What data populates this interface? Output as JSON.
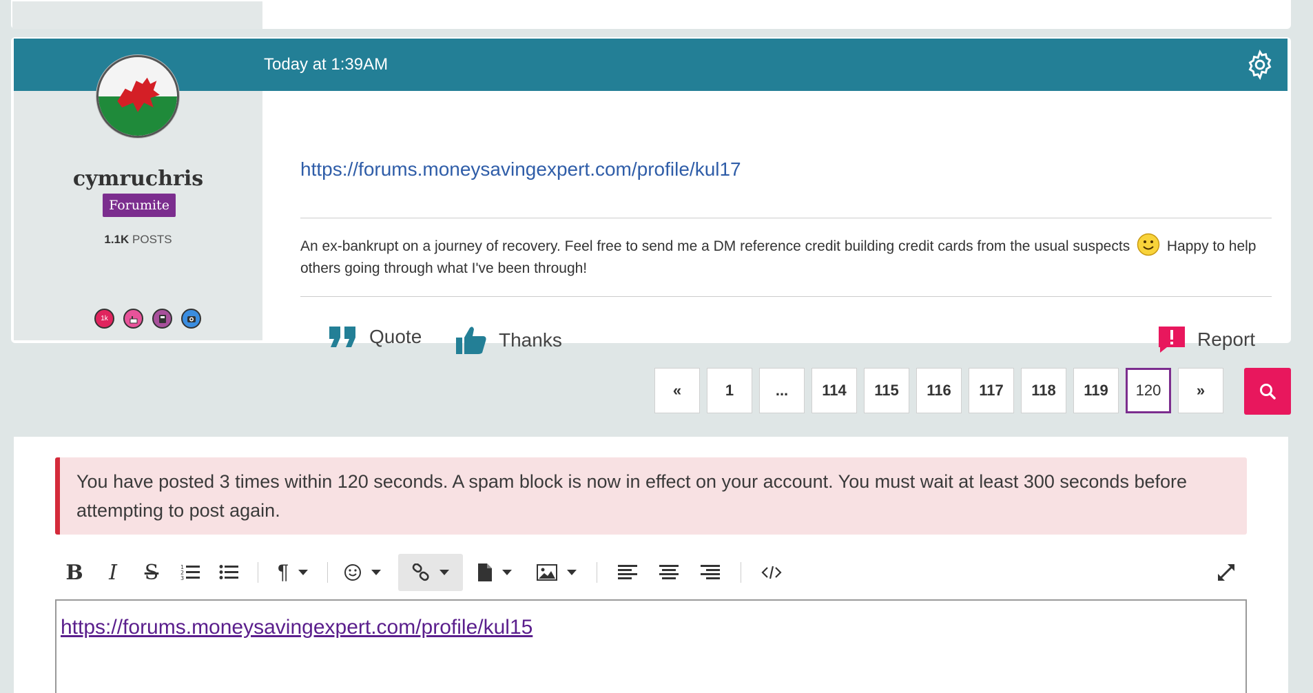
{
  "post": {
    "timestamp": "Today at 1:39AM",
    "author": {
      "username": "cymruchris",
      "rank": "Forumite",
      "post_count": "1.1K",
      "post_label": "POSTS",
      "badges": [
        {
          "icon": "1k-posts-badge",
          "label": "1k",
          "color": "#e0245e"
        },
        {
          "icon": "cake-badge",
          "label": "",
          "color": "#e8539a"
        },
        {
          "icon": "book-badge",
          "label": "",
          "color": "#a8509c"
        },
        {
          "icon": "camera-badge",
          "label": "",
          "color": "#3a8de0"
        }
      ]
    },
    "signature_link": "https://forums.moneysavingexpert.com/profile/kul17",
    "bio_part1": "An ex-bankrupt on a journey of recovery. Feel free to send me a DM reference credit building credit cards from the usual suspects",
    "bio_part2": "Happy to help others going through what I've been through!",
    "actions": {
      "quote": "Quote",
      "thanks": "Thanks",
      "report": "Report"
    }
  },
  "pagination": {
    "prev": "«",
    "pages": [
      "1",
      "...",
      "114",
      "115",
      "116",
      "117",
      "118",
      "119",
      "120"
    ],
    "current": "120",
    "next": "»"
  },
  "alert": {
    "message": "You have posted 3 times within 120 seconds. A spam block is now in effect on your account. You must wait at least 300 seconds before attempting to post again."
  },
  "editor": {
    "content_link": "https://forums.moneysavingexpert.com/profile/kul15"
  },
  "colors": {
    "header": "#237f96",
    "rank": "#7b2d8e",
    "search": "#e8175d",
    "alert_border": "#d42b3b"
  }
}
